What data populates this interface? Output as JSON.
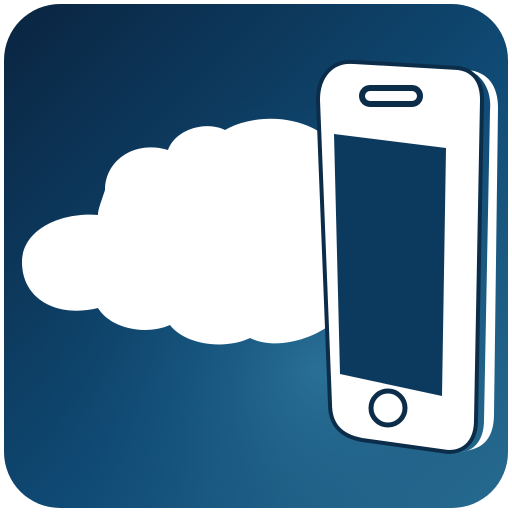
{
  "app_icon": {
    "icon_name": "cloud-phone-sync-icon",
    "parts": [
      "cloud-icon",
      "smartphone-icon"
    ],
    "colors": {
      "background_dark": "#0a2440",
      "background_mid": "#0f4a74",
      "background_light": "#2a6e92",
      "cloud": "#ffffff",
      "phone_body": "#ffffff",
      "phone_screen": "#0c3a5e",
      "phone_outline": "#0c2d4a"
    }
  }
}
